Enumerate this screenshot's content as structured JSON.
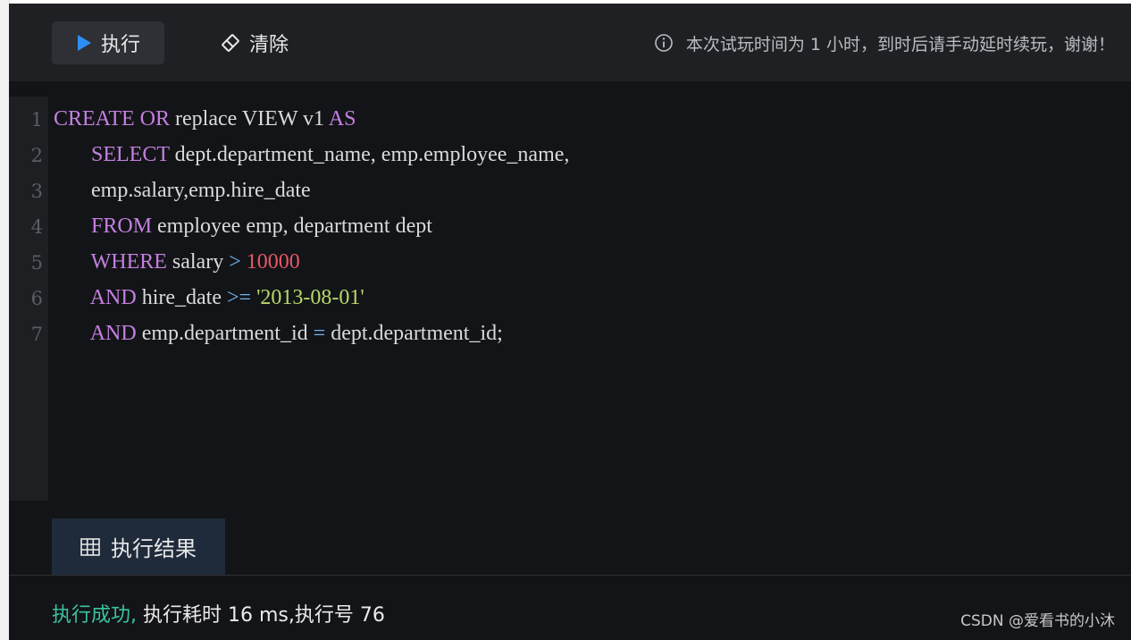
{
  "toolbar": {
    "run_label": "执行",
    "clear_label": "清除",
    "notice": "本次试玩时间为 1 小时，到时后请手动延时续玩，谢谢！",
    "icons": {
      "run": "play-icon",
      "clear": "eraser-icon",
      "notice": "info-icon"
    }
  },
  "editor": {
    "line_numbers": [
      "1",
      "2",
      "3",
      "4",
      "5",
      "6",
      "7"
    ],
    "lines": [
      [
        {
          "t": "CREATE",
          "c": "kw"
        },
        {
          "t": " OR ",
          "c": "kw"
        },
        {
          "t": "replace VIEW v1 ",
          "c": ""
        },
        {
          "t": "AS",
          "c": "kw"
        }
      ],
      [
        {
          "t": "       ",
          "c": ""
        },
        {
          "t": "SELECT",
          "c": "kw"
        },
        {
          "t": " dept.department_name, emp.employee_name,",
          "c": ""
        }
      ],
      [
        {
          "t": "       emp.salary,emp.hire_date",
          "c": ""
        }
      ],
      [
        {
          "t": "       ",
          "c": ""
        },
        {
          "t": "FROM",
          "c": "kw"
        },
        {
          "t": " employee emp, department dept",
          "c": ""
        }
      ],
      [
        {
          "t": "       ",
          "c": ""
        },
        {
          "t": "WHERE",
          "c": "kw"
        },
        {
          "t": " salary ",
          "c": ""
        },
        {
          "t": ">",
          "c": "op"
        },
        {
          "t": " ",
          "c": ""
        },
        {
          "t": "10000",
          "c": "num"
        }
      ],
      [
        {
          "t": "       ",
          "c": ""
        },
        {
          "t": "AND",
          "c": "kw"
        },
        {
          "t": " hire_date ",
          "c": ""
        },
        {
          "t": ">=",
          "c": "op"
        },
        {
          "t": " ",
          "c": ""
        },
        {
          "t": "'2013-08-01'",
          "c": "str"
        }
      ],
      [
        {
          "t": "       ",
          "c": ""
        },
        {
          "t": "AND",
          "c": "kw"
        },
        {
          "t": " emp.department_id ",
          "c": ""
        },
        {
          "t": "=",
          "c": "op"
        },
        {
          "t": " dept.department_id;",
          "c": ""
        }
      ]
    ]
  },
  "results": {
    "tab_label": "执行结果",
    "tab_icon": "table-icon",
    "status_success": "执行成功,",
    "status_detail": " 执行耗时 16 ms,执行号 76"
  },
  "watermark": "CSDN @爱看书的小沐",
  "colors": {
    "keyword": "#c47fe0",
    "number": "#e8576a",
    "string": "#b7d96a",
    "operator": "#6fb4f0",
    "success": "#3cc2a0",
    "accent_play": "#2f8df5"
  }
}
